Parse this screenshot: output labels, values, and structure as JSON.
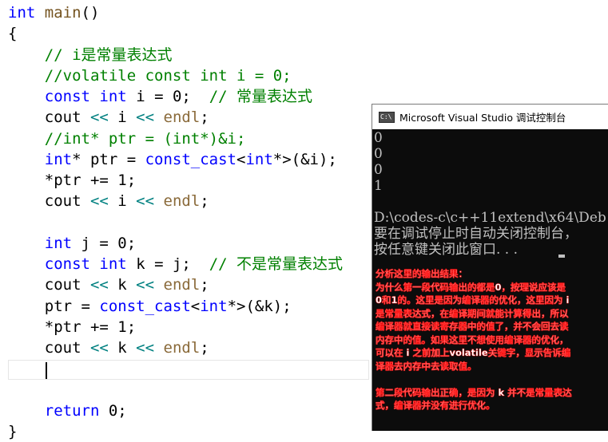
{
  "editor": {
    "lines": [
      {
        "segments": [
          {
            "t": "int",
            "c": "kw"
          },
          {
            "t": " ",
            "c": "pl"
          },
          {
            "t": "main",
            "c": "fn"
          },
          {
            "t": "()",
            "c": "pl"
          }
        ]
      },
      {
        "segments": [
          {
            "t": "{",
            "c": "pl"
          }
        ]
      },
      {
        "segments": [
          {
            "t": "    ",
            "c": "pl"
          },
          {
            "t": "// i是常量表达式",
            "c": "cm"
          }
        ]
      },
      {
        "segments": [
          {
            "t": "    ",
            "c": "pl"
          },
          {
            "t": "//volatile const int i = 0;",
            "c": "cm"
          }
        ]
      },
      {
        "segments": [
          {
            "t": "    ",
            "c": "pl"
          },
          {
            "t": "const",
            "c": "kw"
          },
          {
            "t": " ",
            "c": "pl"
          },
          {
            "t": "int",
            "c": "kw"
          },
          {
            "t": " i = 0;  ",
            "c": "pl"
          },
          {
            "t": "// 常量表达式",
            "c": "cm"
          }
        ]
      },
      {
        "segments": [
          {
            "t": "    cout ",
            "c": "pl"
          },
          {
            "t": "<<",
            "c": "op"
          },
          {
            "t": " i ",
            "c": "pl"
          },
          {
            "t": "<<",
            "c": "op"
          },
          {
            "t": " ",
            "c": "pl"
          },
          {
            "t": "endl",
            "c": "ed"
          },
          {
            "t": ";",
            "c": "pl"
          }
        ]
      },
      {
        "segments": [
          {
            "t": "    ",
            "c": "pl"
          },
          {
            "t": "//int* ptr = (int*)&i;",
            "c": "cm"
          }
        ]
      },
      {
        "segments": [
          {
            "t": "    ",
            "c": "pl"
          },
          {
            "t": "int",
            "c": "kw"
          },
          {
            "t": "* ptr = ",
            "c": "pl"
          },
          {
            "t": "const_cast",
            "c": "kw"
          },
          {
            "t": "<",
            "c": "pl"
          },
          {
            "t": "int",
            "c": "kw"
          },
          {
            "t": "*>(&i);",
            "c": "pl"
          }
        ]
      },
      {
        "segments": [
          {
            "t": "    *ptr += 1;",
            "c": "pl"
          }
        ]
      },
      {
        "segments": [
          {
            "t": "    cout ",
            "c": "pl"
          },
          {
            "t": "<<",
            "c": "op"
          },
          {
            "t": " i ",
            "c": "pl"
          },
          {
            "t": "<<",
            "c": "op"
          },
          {
            "t": " ",
            "c": "pl"
          },
          {
            "t": "endl",
            "c": "ed"
          },
          {
            "t": ";",
            "c": "pl"
          }
        ]
      },
      {
        "segments": []
      },
      {
        "segments": [
          {
            "t": "    ",
            "c": "pl"
          },
          {
            "t": "int",
            "c": "kw"
          },
          {
            "t": " j = 0;",
            "c": "pl"
          }
        ]
      },
      {
        "segments": [
          {
            "t": "    ",
            "c": "pl"
          },
          {
            "t": "const",
            "c": "kw"
          },
          {
            "t": " ",
            "c": "pl"
          },
          {
            "t": "int",
            "c": "kw"
          },
          {
            "t": " k = j;  ",
            "c": "pl"
          },
          {
            "t": "// 不是常量表达式",
            "c": "cm"
          }
        ]
      },
      {
        "segments": [
          {
            "t": "    cout ",
            "c": "pl"
          },
          {
            "t": "<<",
            "c": "op"
          },
          {
            "t": " k ",
            "c": "pl"
          },
          {
            "t": "<<",
            "c": "op"
          },
          {
            "t": " ",
            "c": "pl"
          },
          {
            "t": "endl",
            "c": "ed"
          },
          {
            "t": ";",
            "c": "pl"
          }
        ]
      },
      {
        "segments": [
          {
            "t": "    ptr = ",
            "c": "pl"
          },
          {
            "t": "const_cast",
            "c": "kw"
          },
          {
            "t": "<",
            "c": "pl"
          },
          {
            "t": "int",
            "c": "kw"
          },
          {
            "t": "*>(&k);",
            "c": "pl"
          }
        ]
      },
      {
        "segments": [
          {
            "t": "    *ptr += 1;",
            "c": "pl"
          }
        ]
      },
      {
        "segments": [
          {
            "t": "    cout ",
            "c": "pl"
          },
          {
            "t": "<<",
            "c": "op"
          },
          {
            "t": " k ",
            "c": "pl"
          },
          {
            "t": "<<",
            "c": "op"
          },
          {
            "t": " ",
            "c": "pl"
          },
          {
            "t": "endl",
            "c": "ed"
          },
          {
            "t": ";",
            "c": "pl"
          }
        ]
      },
      {
        "segments": []
      },
      {
        "segments": []
      },
      {
        "segments": [
          {
            "t": "    ",
            "c": "pl"
          },
          {
            "t": "return",
            "c": "kw"
          },
          {
            "t": " 0;",
            "c": "pl"
          }
        ]
      },
      {
        "segments": [
          {
            "t": "}",
            "c": "pl"
          }
        ]
      }
    ]
  },
  "console": {
    "icon_text": "C:\\",
    "title": "Microsoft Visual Studio 调试控制台",
    "output_lines": [
      "0",
      "0",
      "0",
      "1",
      "",
      "D:\\codes-c\\c++11extend\\x64\\Deb",
      "要在调试停止时自动关闭控制台，",
      "按任意键关闭此窗口. . ."
    ]
  },
  "annotation": {
    "lines": [
      "分析这里的输出结果：",
      "为什么第一段代码输出的都是0，按理说应该是",
      "0和1的。这里是因为编译器的优化，这里因为 i",
      "是常量表达式，在编译期间就能计算得出，所以",
      "编译器就直接读寄存器中的值了，并不会回去读",
      "内存中的值。如果这里不想使用编译器的优化，",
      "可以在 i 之前加上volatile关键字，显示告诉编",
      "译器去内存中去读取值。",
      "",
      "第二段代码输出正确，是因为 k 并不是常量表达",
      "式，编译器并没有进行优化。"
    ]
  },
  "colors": {
    "keyword": "#0000ff",
    "comment": "#008000",
    "operator": "#008080",
    "annotation_text": "#ff0000",
    "console_bg": "#0c0c0c"
  }
}
